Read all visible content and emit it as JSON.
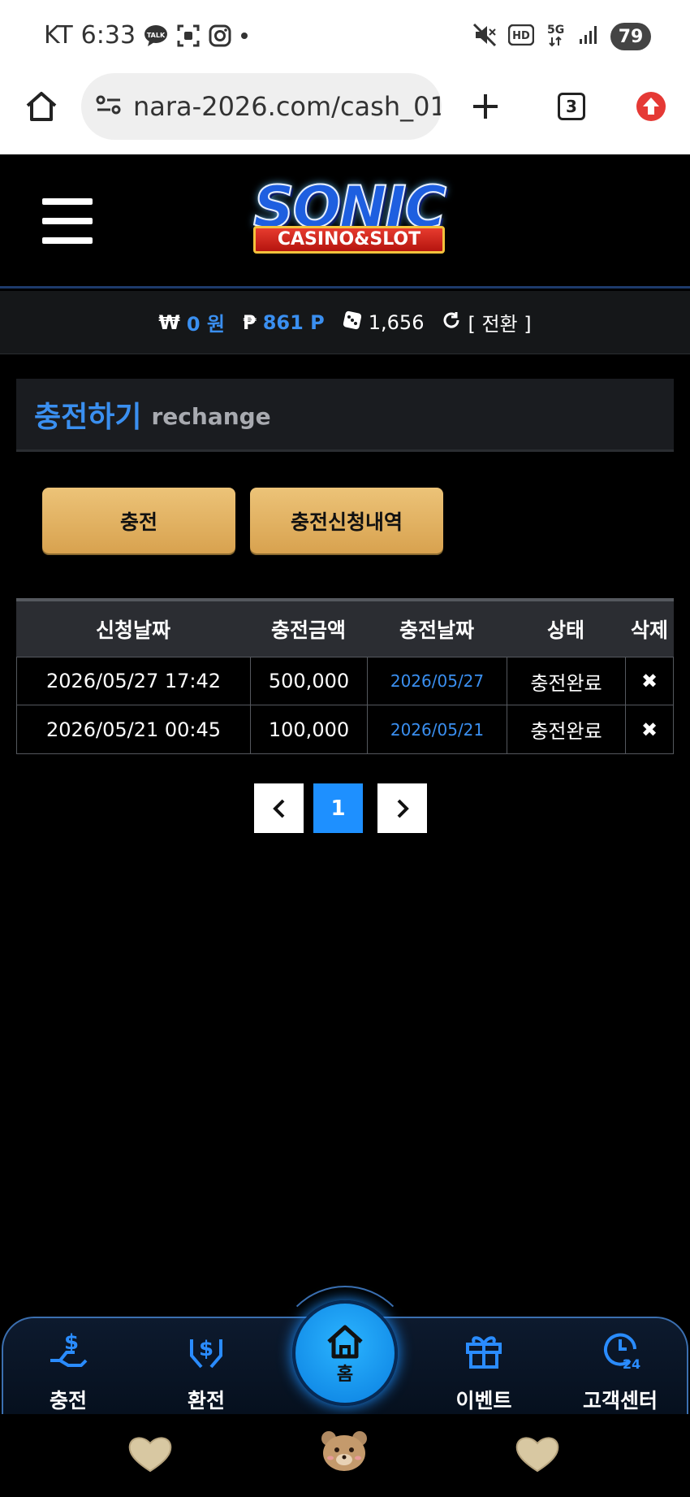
{
  "status_bar": {
    "carrier": "KT",
    "time": "6:33",
    "talk_label": "TALK",
    "network": "5G",
    "hd_label": "HD",
    "battery": "79"
  },
  "browser": {
    "url": "nara-2026.com/cash_01",
    "tab_count": "3"
  },
  "header": {
    "logo_main": "SONIC",
    "logo_sub": "CASINO&SLOT"
  },
  "balance": {
    "won_symbol": "₩",
    "won_value": "0 원",
    "point_symbol": "₱",
    "point_value": "861 P",
    "dice_value": "1,656",
    "convert_label": "[ 전환 ]"
  },
  "page": {
    "title": "충전하기",
    "subtitle": "rechange"
  },
  "buttons": {
    "charge": "충전",
    "history": "충전신청내역"
  },
  "table": {
    "headers": [
      "신청날짜",
      "충전금액",
      "충전날짜",
      "상태",
      "삭제"
    ],
    "rows": [
      {
        "request_date": "2026/05/27 17:42",
        "amount": "500,000",
        "charge_date": "2026/05/27",
        "status": "충전완료",
        "delete": "✖"
      },
      {
        "request_date": "2026/05/21 00:45",
        "amount": "100,000",
        "charge_date": "2026/05/21",
        "status": "충전완료",
        "delete": "✖"
      }
    ]
  },
  "pagination": {
    "prev": "‹",
    "current": "1",
    "next": "›"
  },
  "bottom_nav": {
    "items": [
      {
        "label": "충전",
        "icon": "deposit-icon"
      },
      {
        "label": "환전",
        "icon": "withdraw-icon"
      },
      {
        "label": "홈",
        "icon": "home-icon"
      },
      {
        "label": "이벤트",
        "icon": "gift-icon"
      },
      {
        "label": "고객센터",
        "icon": "support-24-icon"
      }
    ]
  },
  "colors": {
    "accent_blue": "#3a8ff0",
    "gold_button": "#e3b564",
    "background": "#000000"
  }
}
